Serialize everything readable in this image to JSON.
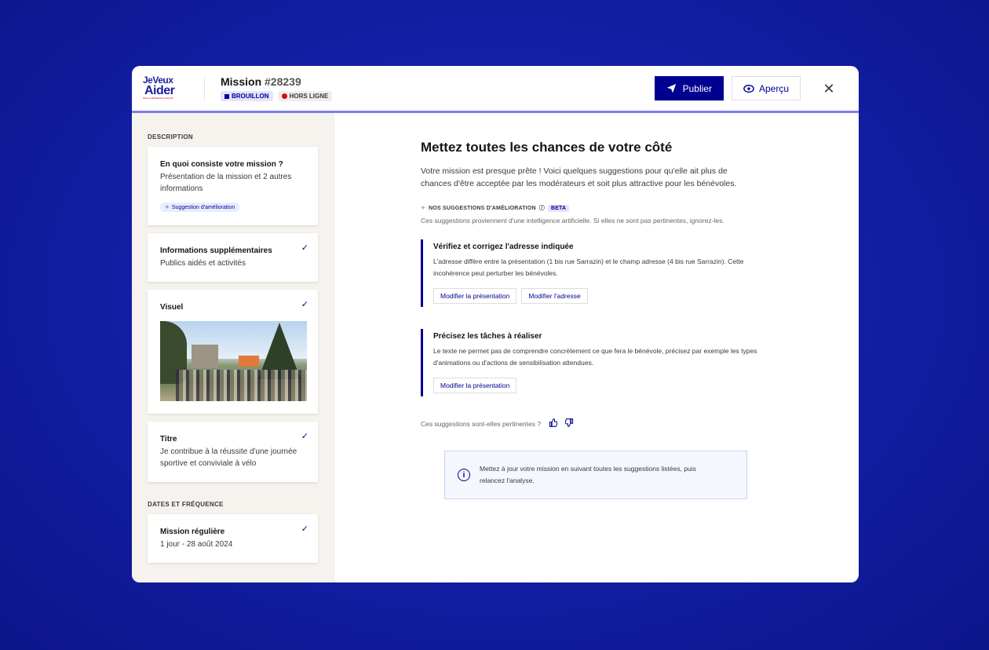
{
  "header": {
    "logo": {
      "line1": "JeVeux",
      "line2": "Aider",
      "tagline": "PAR LA RÉSERVE CIVIQUE"
    },
    "title_prefix": "Mission",
    "title_number": "#28239",
    "badges": {
      "status": "BROUILLON",
      "connection": "HORS LIGNE"
    },
    "publish_label": "Publier",
    "preview_label": "Aperçu",
    "close_label": "✕"
  },
  "sidebar": {
    "section_description": "DESCRIPTION",
    "cards": [
      {
        "title": "En quoi consiste votre mission ?",
        "subtitle": "Présentation de la mission et 2 autres informations",
        "chip": "Suggestion d'amélioration"
      },
      {
        "title": "Informations supplémentaires",
        "subtitle": "Publics aidés et activités"
      },
      {
        "title": "Visuel"
      },
      {
        "title": "Titre",
        "subtitle": "Je contribue à la réussite d'une journée sportive et conviviale à vélo"
      }
    ],
    "section_dates": "DATES ET FRÉQUENCE",
    "dates_card": {
      "title": "Mission régulière",
      "subtitle": "1 jour - 28 août 2024"
    }
  },
  "main": {
    "title": "Mettez toutes les chances de votre côté",
    "intro": "Votre mission est presque prête ! Voici quelques suggestions pour qu'elle ait plus de chances d'être acceptée par les modérateurs et soit plus attractive pour les bénévoles.",
    "suggestions_label": "NOS SUGGESTIONS D'AMÉLIORATION",
    "beta": "BETA",
    "suggestions_note": "Ces suggestions proviennent d'une intelligence artificielle. Si elles ne sont pas pertinentes, ignorez-les.",
    "suggestions": [
      {
        "title": "Vérifiez et corrigez l'adresse indiquée",
        "text": "L'adresse diffère entre la présentation (1 bis rue Sarrazin) et le champ adresse (4 bis rue Sarrazin). Cette incohérence peut perturber les bénévoles.",
        "actions": [
          "Modifier la présentation",
          "Modifier l'adresse"
        ]
      },
      {
        "title": "Précisez les tâches à réaliser",
        "text": "Le texte ne permet pas de comprendre concrètement ce que fera le bénévole, précisez par exemple les types d'animations ou d'actions de sensibilisation attendues.",
        "actions": [
          "Modifier la présentation"
        ]
      }
    ],
    "feedback_question": "Ces suggestions sont-elles pertinentes ?",
    "info_text": "Mettez à jour votre mission en suivant toutes les suggestions listées, puis relancez l'analyse."
  },
  "colors": {
    "primary": "#000091",
    "accent_line": "#7b7ef0",
    "sidebar_bg": "#f6f3ee",
    "offline_dot": "#e1000f"
  }
}
